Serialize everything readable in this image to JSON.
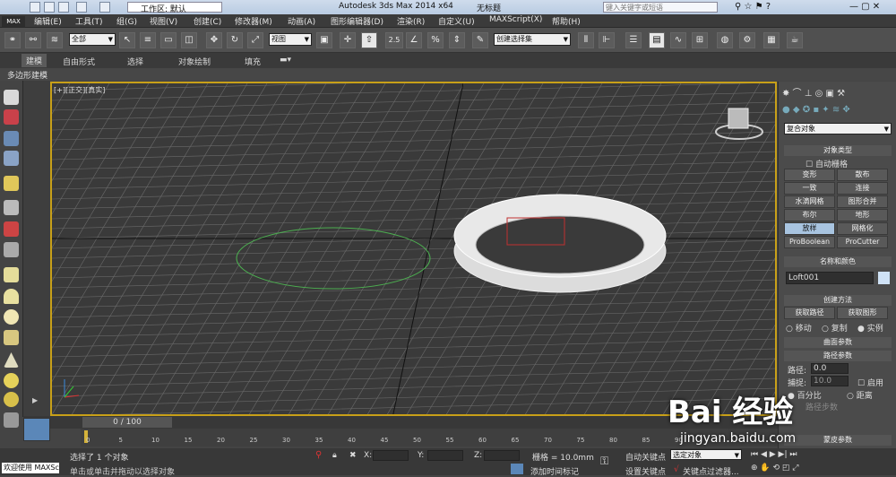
{
  "titlebar": {
    "workspace_label": "工作区: 默认",
    "app_title": "Autodesk 3ds Max  2014 x64",
    "file": "无标题",
    "search_placeholder": "键入关键字或短语"
  },
  "menu": [
    "编辑(E)",
    "工具(T)",
    "组(G)",
    "视图(V)",
    "创建(C)",
    "修改器(M)",
    "动画(A)",
    "图形编辑器(D)",
    "渲染(R)",
    "自定义(U)",
    "MAXScript(X)",
    "帮助(H)"
  ],
  "toolbar": {
    "filter": "全部",
    "refcoord": "视图",
    "selset": "创建选择集",
    "snap_angle": "2.5"
  },
  "ribbon": {
    "tabs": [
      "建模",
      "自由形式",
      "选择",
      "对象绘制",
      "填充"
    ],
    "sub": "多边形建模"
  },
  "viewport": {
    "label": "[+][正交][真实]"
  },
  "cmd": {
    "category": "复合对象",
    "object_type": "对象类型",
    "auto_grid": "自动栅格",
    "buttons": [
      "变形",
      "散布",
      "一致",
      "连接",
      "水滴网格",
      "图形合并",
      "布尔",
      "地形",
      "放样",
      "网格化",
      "ProBoolean",
      "ProCutter"
    ],
    "name_color": "名称和颜色",
    "obj_name": "Loft001",
    "creation_method": "创建方法",
    "get_path": "获取路径",
    "get_shape": "获取图形",
    "move": "移动",
    "copy": "复制",
    "instance": "实例",
    "surface_params": "曲面参数",
    "path_params": "路径参数",
    "path_label": "路径:",
    "path_val": "0.0",
    "snap_label": "捕捉:",
    "snap_val": "10.0",
    "snap_on": "启用",
    "percent": "百分比",
    "distance": "距离",
    "path_steps": "路径步数",
    "skin": "蒙皮参数"
  },
  "timeline": {
    "frame": "0 / 100",
    "ticks": [
      "0",
      "5",
      "10",
      "15",
      "20",
      "25",
      "30",
      "35",
      "40",
      "45",
      "50",
      "55",
      "60",
      "65",
      "70",
      "75",
      "80",
      "85",
      "90"
    ]
  },
  "status": {
    "mini": "欢迎使用 MAXSc",
    "selected": "选择了 1 个对象",
    "hint": "单击或单击并拖动以选择对象",
    "x": "X:",
    "y": "Y:",
    "z": "Z:",
    "grid": "栅格 = 10.0mm",
    "autokey": "自动关键点",
    "setkey": "设置关键点",
    "keyfilter": "关键点过滤器...",
    "selobj": "选定对象",
    "addtime": "添加时间标记"
  },
  "watermark": {
    "text": "Bai 经验",
    "url": "jingyan.baidu.com"
  }
}
